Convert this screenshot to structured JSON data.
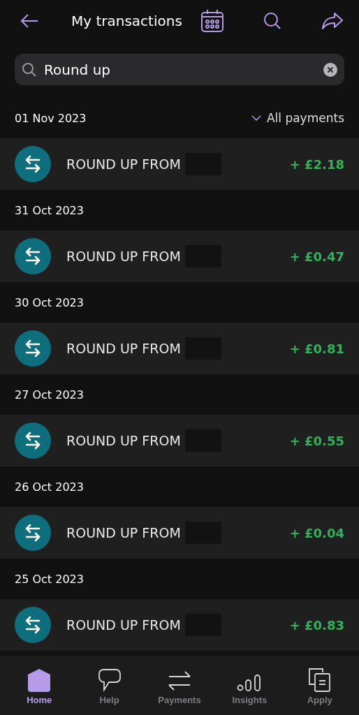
{
  "header": {
    "title": "My transactions"
  },
  "search": {
    "value": "Round up"
  },
  "filter": {
    "label": "All payments"
  },
  "groups": [
    {
      "date": "01 Nov 2023",
      "transactions": [
        {
          "description": "ROUND UP FROM",
          "amount": "+ £2.18"
        }
      ]
    },
    {
      "date": "31 Oct 2023",
      "transactions": [
        {
          "description": "ROUND UP FROM",
          "amount": "+ £0.47"
        }
      ]
    },
    {
      "date": "30 Oct 2023",
      "transactions": [
        {
          "description": "ROUND UP FROM",
          "amount": "+ £0.81"
        }
      ]
    },
    {
      "date": "27 Oct 2023",
      "transactions": [
        {
          "description": "ROUND UP FROM",
          "amount": "+ £0.55"
        }
      ]
    },
    {
      "date": "26 Oct 2023",
      "transactions": [
        {
          "description": "ROUND UP FROM",
          "amount": "+ £0.04"
        }
      ]
    },
    {
      "date": "25 Oct 2023",
      "transactions": [
        {
          "description": "ROUND UP FROM",
          "amount": "+ £0.83"
        }
      ]
    }
  ],
  "nav": [
    {
      "label": "Home",
      "kind": "home",
      "selected": true
    },
    {
      "label": "Help",
      "kind": "help",
      "selected": false
    },
    {
      "label": "Payments",
      "kind": "payments",
      "selected": false
    },
    {
      "label": "Insights",
      "kind": "insights",
      "selected": false
    },
    {
      "label": "Apply",
      "kind": "apply",
      "selected": false
    }
  ]
}
